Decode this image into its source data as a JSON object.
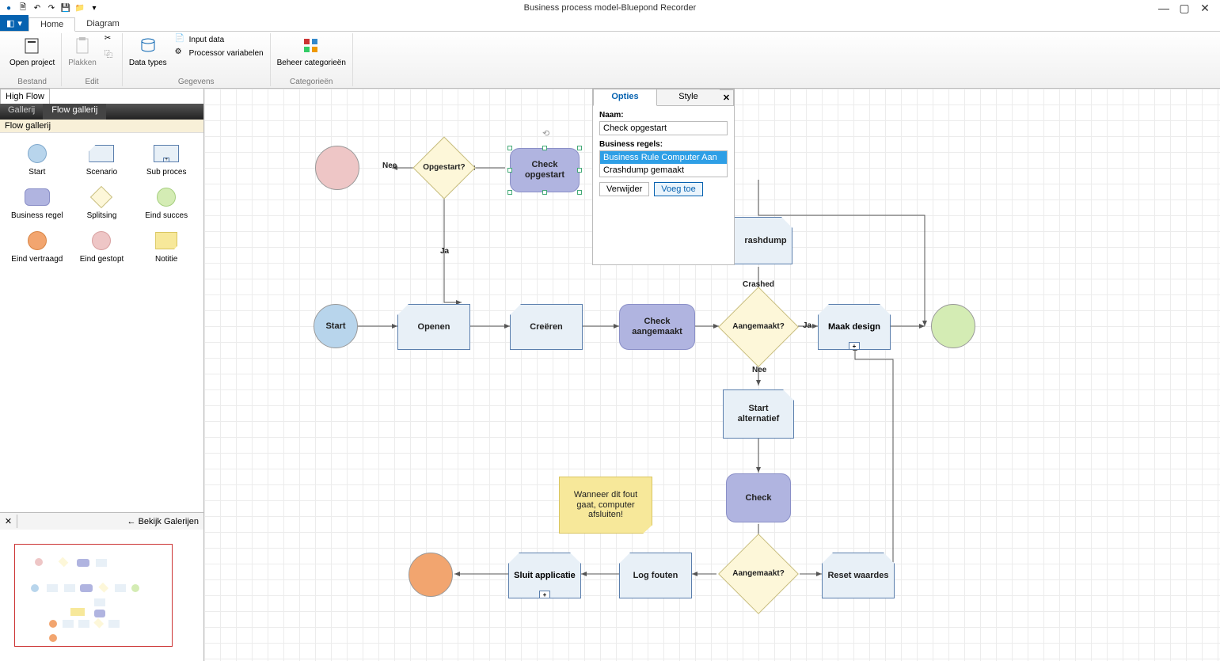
{
  "title": "Business process model-Bluepond Recorder",
  "titlebar_icons": {
    "logo": "●",
    "new": "🗎",
    "undo": "↶",
    "redo": "↷",
    "save": "💾",
    "folder": "📁"
  },
  "window_buttons": {
    "min": "—",
    "max": "▢",
    "close": "✕"
  },
  "ribbon": {
    "file": "⬚ ▾",
    "tabs": {
      "home": "Home",
      "diagram": "Diagram"
    },
    "groups": {
      "bestand": {
        "label": "Bestand",
        "open_project": "Open\nproject"
      },
      "edit": {
        "label": "Edit",
        "plakken": "Plakken"
      },
      "gegevens": {
        "label": "Gegevens",
        "data_types": "Data\ntypes",
        "input_data": "Input data",
        "proc_vars": "Processor variabelen"
      },
      "categorieen": {
        "label": "Categorieën",
        "beheer": "Beheer\ncategorieën"
      }
    }
  },
  "left": {
    "high_flow": "High Flow",
    "tabs": {
      "gallerij": "Gallerij",
      "flow_gallerij": "Flow gallerij"
    },
    "sub": "Flow gallerij",
    "items": [
      {
        "key": "start",
        "label": "Start"
      },
      {
        "key": "scenario",
        "label": "Scenario"
      },
      {
        "key": "subproces",
        "label": "Sub proces"
      },
      {
        "key": "businessregel",
        "label": "Business\nregel"
      },
      {
        "key": "splitsing",
        "label": "Splitsing"
      },
      {
        "key": "eindsucces",
        "label": "Eind succes"
      },
      {
        "key": "eindvertraagd",
        "label": "Eind\nvertraagd"
      },
      {
        "key": "eindgestopt",
        "label": "Eind\ngestopt"
      },
      {
        "key": "notitie",
        "label": "Notitie"
      }
    ],
    "footer": {
      "close": "✕",
      "back": "← Bekijk Galerijen"
    }
  },
  "panel": {
    "tabs": {
      "opties": "Opties",
      "style": "Style"
    },
    "close": "✕",
    "naam_label": "Naam:",
    "naam_value": "Check opgestart",
    "br_label": "Business regels:",
    "br_items": [
      "Business Rule Computer Aan",
      "Crashdump gemaakt"
    ],
    "btn_verwijder": "Verwijder",
    "btn_voegtoe": "Voeg toe"
  },
  "flow": {
    "n_start": "Start",
    "n_openen": "Openen",
    "n_creeren": "Creëren",
    "n_check_aangemaakt": "Check aangemaakt",
    "n_aangemaakt_q": "Aangemaakt?",
    "n_maak_design": "Maak design",
    "n_opgestart_q": "Opgestart?",
    "n_check_opgestart": "Check opgestart",
    "n_crashdump": "rashdump",
    "n_start_alt": "Start alternatief",
    "n_check": "Check",
    "n_aangemaakt2_q": "Aangemaakt?",
    "n_reset": "Reset waardes",
    "n_logfouten": "Log fouten",
    "n_sluit": "Sluit applicatie",
    "n_note": "Wanneer dit fout gaat, computer afsluiten!",
    "e_nee": "Nee",
    "e_ja": "Ja",
    "e_crashed": "Crashed",
    "e_nee2": "Nee",
    "e_ja2": "Ja"
  }
}
